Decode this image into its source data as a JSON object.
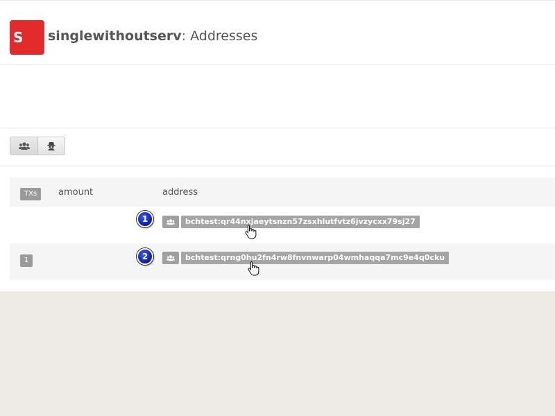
{
  "header": {
    "logo_letter": "S",
    "wallet_name": "singlewithoutserv",
    "separator": ":",
    "page_title": "Addresses",
    "logo_color": "#e22b2b"
  },
  "toolbar": {
    "buttons": [
      {
        "icon": "users-icon"
      },
      {
        "icon": "spy-icon"
      }
    ]
  },
  "table": {
    "headers": {
      "txs": "TXs",
      "amount": "amount",
      "address": "address"
    },
    "rows": [
      {
        "marker": "1",
        "txs": "",
        "amount": "",
        "address": "bchtest:qr44nxjaeytsnzn57zsxhlutfvtz6jvzycxx79sj27"
      },
      {
        "marker": "2",
        "txs": "1",
        "amount": "",
        "address": "bchtest:qrng0hu2fn4rw8fnvnwarp04wmhaqqa7mc9e4q0cku"
      }
    ]
  }
}
